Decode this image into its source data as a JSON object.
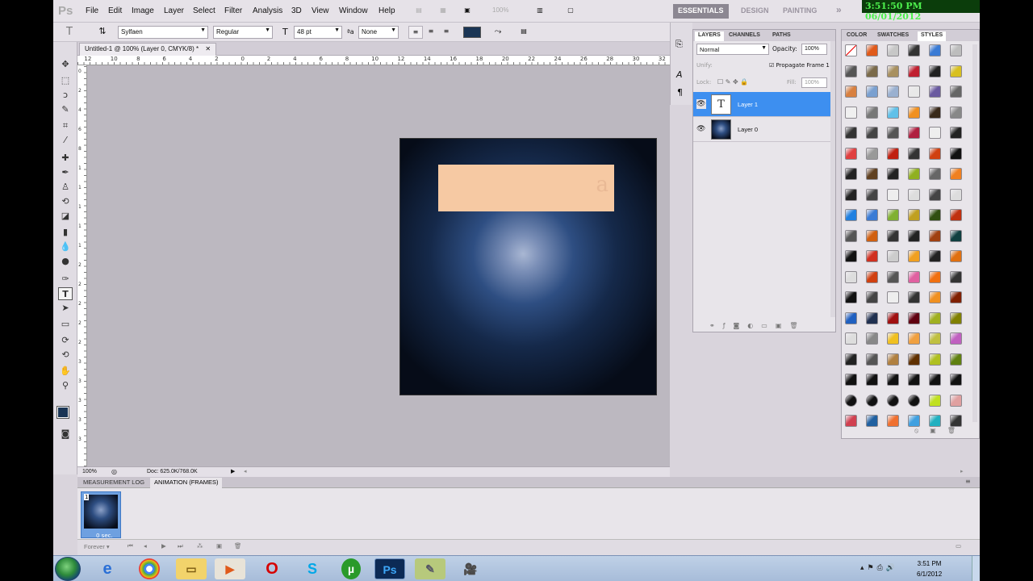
{
  "app": {
    "logo": "Ps"
  },
  "menu": [
    "File",
    "Edit",
    "Image",
    "Layer",
    "Select",
    "Filter",
    "Analysis",
    "3D",
    "View",
    "Window",
    "Help"
  ],
  "menu_extra": {
    "zoom": "100%"
  },
  "workspaces": [
    "ESSENTIALS",
    "DESIGN",
    "PAINTING"
  ],
  "clock_overlay": "3:51:50 PM 06/01/2012",
  "options": {
    "font_family": "Sylfaen",
    "font_style": "Regular",
    "font_size": "48 pt",
    "antialias": "None",
    "color_hex": "#1a3555"
  },
  "document": {
    "tab_title": "Untitled-1 @ 100% (Layer 0, CMYK/8) *",
    "zoom": "100%",
    "doc_info": "Doc: 625.0K/768.0K"
  },
  "ruler_h_labels": [
    "12",
    "10",
    "8",
    "6",
    "4",
    "2",
    "0",
    "2",
    "4",
    "6",
    "8",
    "10",
    "12",
    "14",
    "16",
    "18",
    "20",
    "22",
    "24",
    "26",
    "28",
    "30",
    "32"
  ],
  "ruler_v_labels": [
    "0",
    "2",
    "4",
    "6",
    "8",
    "1",
    "1",
    "1",
    "1",
    "1",
    "2",
    "2",
    "2",
    "2",
    "2",
    "3",
    "3",
    "3",
    "3",
    "3"
  ],
  "animation": {
    "tabs": [
      "MEASUREMENT LOG",
      "ANIMATION (FRAMES)"
    ],
    "frame_number": "1",
    "frame_delay": "0 sec.",
    "loop": "Forever"
  },
  "layers_panel": {
    "tabs": [
      "LAYERS",
      "CHANNELS",
      "PATHS"
    ],
    "blend_mode": "Normal",
    "opacity_label": "Opacity:",
    "opacity_value": "100%",
    "unify_label": "Unify:",
    "propagate_label": "Propagate Frame 1",
    "lock_label": "Lock:",
    "fill_label": "Fill:",
    "fill_value": "100%",
    "layers": [
      {
        "name": "Layer 1",
        "type": "text",
        "selected": true
      },
      {
        "name": "Layer 0",
        "type": "image",
        "selected": false
      }
    ]
  },
  "styles_panel": {
    "tabs": [
      "COLOR",
      "SWATCHES",
      "STYLES"
    ]
  },
  "taskbar": {
    "time": "3:51 PM",
    "date": "6/1/2012"
  },
  "colors": {
    "accent": "#3d8ff0",
    "foreground": "#1a3555",
    "background": "#6a1e63",
    "canvas_text_box": "#f6c9a3"
  }
}
